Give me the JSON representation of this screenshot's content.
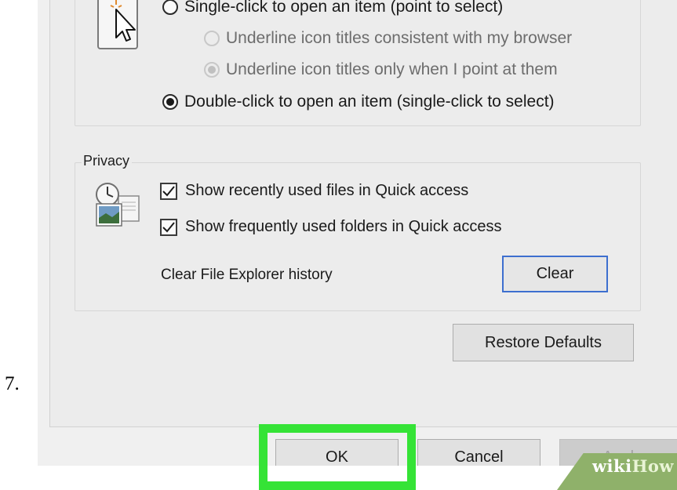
{
  "step_number": "7.",
  "click_items": {
    "single_click": "Single-click to open an item (point to select)",
    "underline_browser": "Underline icon titles consistent with my browser",
    "underline_point": "Underline icon titles only when I point at them",
    "double_click": "Double-click to open an item (single-click to select)"
  },
  "privacy": {
    "legend": "Privacy",
    "show_recent_files": "Show recently used files in Quick access",
    "show_frequent_folders": "Show frequently used folders in Quick access",
    "clear_history_label": "Clear File Explorer history",
    "clear_button": "Clear"
  },
  "restore_defaults_button": "Restore Defaults",
  "footer": {
    "ok": "OK",
    "cancel": "Cancel",
    "apply": "Apply"
  },
  "watermark": {
    "wiki": "wiki",
    "how": "How"
  },
  "colors": {
    "highlight": "#35e336",
    "focus_border": "#3d6fcf",
    "watermark_bg": "#8fb16a"
  }
}
